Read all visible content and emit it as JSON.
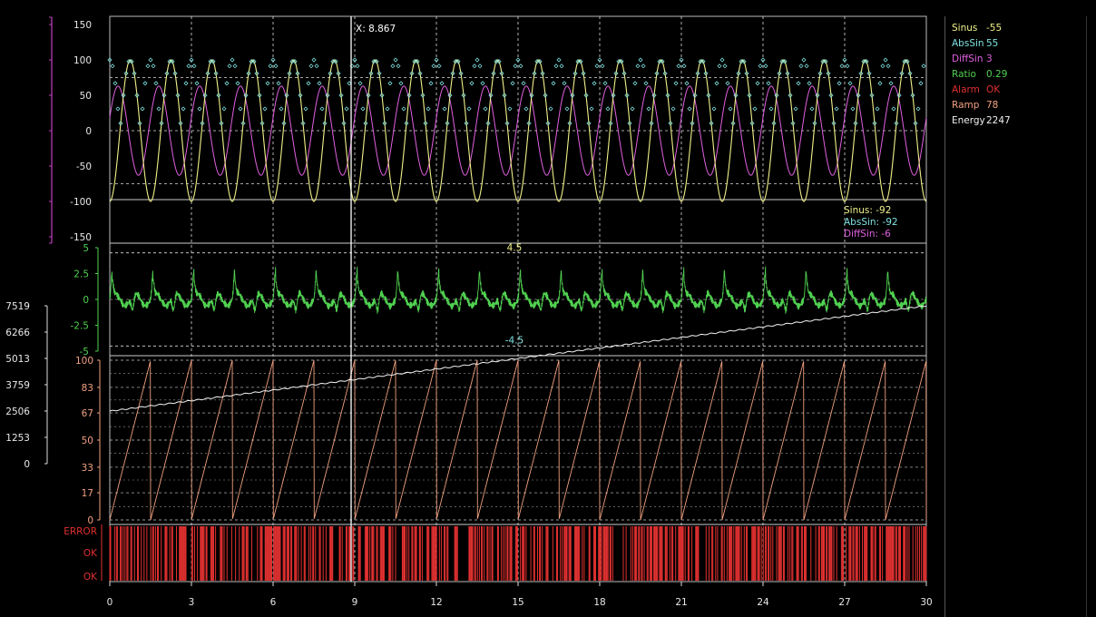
{
  "cursor": {
    "label": "X: 8.867",
    "x": 8.867
  },
  "legend": [
    {
      "name": "Sinus",
      "value": "-55",
      "color": "#f0f08a"
    },
    {
      "name": "AbsSin",
      "value": "55",
      "color": "#7fe0e0"
    },
    {
      "name": "DiffSin",
      "value": "3",
      "color": "#e060e0"
    },
    {
      "name": "Ratio",
      "value": "0.29",
      "color": "#50d050"
    },
    {
      "name": "Alarm",
      "value": "OK",
      "color": "#e03030"
    },
    {
      "name": "Ramp",
      "value": "78",
      "color": "#f0a080"
    },
    {
      "name": "Energy",
      "value": "2247",
      "color": "#f0f0f0"
    }
  ],
  "tooltip": [
    {
      "text": "Sinus: -92",
      "color": "#f0f08a"
    },
    {
      "text": "AbsSin: -92",
      "color": "#7fe0e0"
    },
    {
      "text": "DiffSin: -6",
      "color": "#e060e0"
    }
  ],
  "chart_data": [
    {
      "type": "line",
      "panel": "top",
      "x_range": [
        0,
        30
      ],
      "ylim": [
        -150,
        150
      ],
      "yticks": [
        "150",
        "100",
        "50",
        "0",
        "-50",
        "-100",
        "-150"
      ],
      "series": [
        {
          "name": "Sinus",
          "color": "#f0f08a",
          "amplitude": 100,
          "period": 1.5
        },
        {
          "name": "AbsSin",
          "color": "#7fe0e0",
          "style": "points",
          "range": [
            0,
            100
          ]
        },
        {
          "name": "DiffSin",
          "color": "#e060e0",
          "amplitude": 63,
          "period": 1.5
        }
      ],
      "reference_lines": [
        75,
        -75
      ],
      "grid": true
    },
    {
      "type": "line",
      "panel": "middle",
      "x_range": [
        0,
        30
      ],
      "ylim": [
        -5,
        5
      ],
      "yticks": [
        "5",
        "2.5",
        "0",
        "-2.5",
        "-5"
      ],
      "series": [
        {
          "name": "Ratio",
          "color": "#50d050"
        }
      ],
      "thresholds": [
        {
          "value": 4.5,
          "label": "4.5",
          "color": "#f0f08a"
        },
        {
          "value": -4.5,
          "label": "-4.5",
          "color": "#7fe0e0"
        }
      ]
    },
    {
      "type": "line",
      "panel": "ramp",
      "x_range": [
        0,
        30
      ],
      "ylim": [
        0,
        100
      ],
      "yticks": [
        "100",
        "83",
        "67",
        "50",
        "33",
        "17",
        "0"
      ],
      "series": [
        {
          "name": "Ramp",
          "color": "#f0a080",
          "period": 1.5,
          "range": [
            0,
            100
          ]
        }
      ]
    },
    {
      "type": "line",
      "panel": "energy-axis",
      "x_range": [
        0,
        30
      ],
      "ylim": [
        0,
        7519
      ],
      "yticks": [
        "7519",
        "6266",
        "5013",
        "3759",
        "2506",
        "1253",
        "0"
      ],
      "series": [
        {
          "name": "Energy",
          "color": "#f0f0f0",
          "start": 2500,
          "end": 7519
        }
      ]
    },
    {
      "type": "line",
      "panel": "alarm",
      "x_range": [
        0,
        30
      ],
      "yticks": [
        "ERROR",
        "OK",
        "OK"
      ],
      "series": [
        {
          "name": "Alarm",
          "color": "#e03030",
          "style": "digital"
        }
      ]
    }
  ],
  "x_axis": {
    "ticks": [
      "0",
      "3",
      "6",
      "9",
      "12",
      "15",
      "18",
      "21",
      "24",
      "27",
      "30"
    ]
  }
}
